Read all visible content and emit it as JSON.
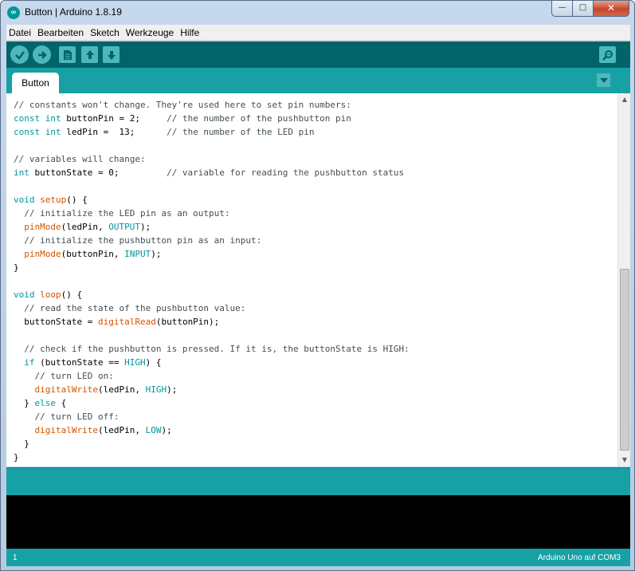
{
  "window": {
    "title": "Button | Arduino 1.8.19",
    "icon": "arduino-logo",
    "minimize": "—",
    "maximize": "□",
    "close": "✕"
  },
  "menu": [
    "Datei",
    "Bearbeiten",
    "Sketch",
    "Werkzeuge",
    "Hilfe"
  ],
  "toolbar": {
    "buttons": [
      {
        "name": "verify",
        "icon": "check-icon"
      },
      {
        "name": "upload",
        "icon": "arrow-right-icon"
      },
      {
        "name": "new",
        "icon": "file-icon"
      },
      {
        "name": "open",
        "icon": "arrow-up-icon"
      },
      {
        "name": "save",
        "icon": "arrow-down-icon"
      },
      {
        "name": "serial-monitor",
        "icon": "magnifier-icon"
      }
    ]
  },
  "tabs": [
    {
      "label": "Button"
    }
  ],
  "editor": {
    "lines": [
      [
        [
          "cm",
          "// constants won't change. They're used here to set pin numbers:"
        ]
      ],
      [
        [
          "kw",
          "const"
        ],
        [
          "",
          " "
        ],
        [
          "kw",
          "int"
        ],
        [
          "",
          " buttonPin = 2;     "
        ],
        [
          "cm",
          "// the number of the pushbutton pin"
        ]
      ],
      [
        [
          "kw",
          "const"
        ],
        [
          "",
          " "
        ],
        [
          "kw",
          "int"
        ],
        [
          "",
          " ledPin =  13;      "
        ],
        [
          "cm",
          "// the number of the LED pin"
        ]
      ],
      [],
      [
        [
          "cm",
          "// variables will change:"
        ]
      ],
      [
        [
          "kw",
          "int"
        ],
        [
          "",
          " buttonState = 0;         "
        ],
        [
          "cm",
          "// variable for reading the pushbutton status"
        ]
      ],
      [],
      [
        [
          "kw",
          "void"
        ],
        [
          "",
          " "
        ],
        [
          "fn",
          "setup"
        ],
        [
          "",
          "() {"
        ]
      ],
      [
        [
          "",
          "  "
        ],
        [
          "cm",
          "// initialize the LED pin as an output:"
        ]
      ],
      [
        [
          "",
          "  "
        ],
        [
          "fn",
          "pinMode"
        ],
        [
          "",
          "(ledPin, "
        ],
        [
          "kw",
          "OUTPUT"
        ],
        [
          "",
          ");"
        ]
      ],
      [
        [
          "",
          "  "
        ],
        [
          "cm",
          "// initialize the pushbutton pin as an input:"
        ]
      ],
      [
        [
          "",
          "  "
        ],
        [
          "fn",
          "pinMode"
        ],
        [
          "",
          "(buttonPin, "
        ],
        [
          "kw",
          "INPUT"
        ],
        [
          "",
          ");"
        ]
      ],
      [
        [
          "",
          "}"
        ]
      ],
      [],
      [
        [
          "kw",
          "void"
        ],
        [
          "",
          " "
        ],
        [
          "fn",
          "loop"
        ],
        [
          "",
          "() {"
        ]
      ],
      [
        [
          "",
          "  "
        ],
        [
          "cm",
          "// read the state of the pushbutton value:"
        ]
      ],
      [
        [
          "",
          "  buttonState = "
        ],
        [
          "fn",
          "digitalRead"
        ],
        [
          "",
          "(buttonPin);"
        ]
      ],
      [],
      [
        [
          "",
          "  "
        ],
        [
          "cm",
          "// check if the pushbutton is pressed. If it is, the buttonState is HIGH:"
        ]
      ],
      [
        [
          "",
          "  "
        ],
        [
          "kw",
          "if"
        ],
        [
          "",
          " (buttonState == "
        ],
        [
          "kw",
          "HIGH"
        ],
        [
          "",
          ") {"
        ]
      ],
      [
        [
          "",
          "    "
        ],
        [
          "cm",
          "// turn LED on:"
        ]
      ],
      [
        [
          "",
          "    "
        ],
        [
          "fn",
          "digitalWrite"
        ],
        [
          "",
          "(ledPin, "
        ],
        [
          "kw",
          "HIGH"
        ],
        [
          "",
          ");"
        ]
      ],
      [
        [
          "",
          "  } "
        ],
        [
          "kw",
          "else"
        ],
        [
          "",
          " {"
        ]
      ],
      [
        [
          "",
          "    "
        ],
        [
          "cm",
          "// turn LED off:"
        ]
      ],
      [
        [
          "",
          "    "
        ],
        [
          "fn",
          "digitalWrite"
        ],
        [
          "",
          "(ledPin, "
        ],
        [
          "kw",
          "LOW"
        ],
        [
          "",
          ");"
        ]
      ],
      [
        [
          "",
          "  }"
        ]
      ],
      [
        [
          "",
          "}"
        ]
      ]
    ]
  },
  "status": {
    "line": "1",
    "board": "Arduino Uno auf COM3"
  },
  "colors": {
    "toolbar": "#006468",
    "tabbar": "#17a1a5",
    "keyword": "#00979c",
    "function": "#d35400",
    "comment": "#434f54"
  }
}
